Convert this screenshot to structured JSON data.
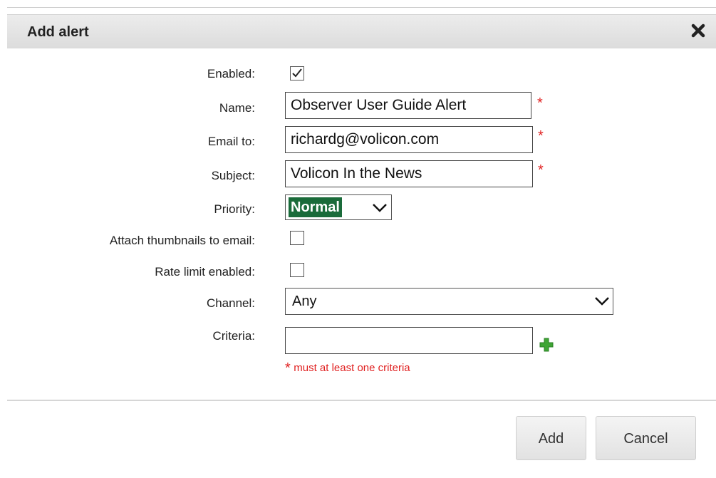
{
  "dialog": {
    "title": "Add alert",
    "close_icon": "close-icon"
  },
  "form": {
    "enabled": {
      "label": "Enabled:",
      "checked": true
    },
    "name": {
      "label": "Name:",
      "value": "Observer User Guide Alert",
      "required_mark": "*"
    },
    "email_to": {
      "label": "Email to:",
      "value": "richardg@volicon.com",
      "required_mark": "*"
    },
    "subject": {
      "label": "Subject:",
      "value": "Volicon In the News",
      "required_mark": "*"
    },
    "priority": {
      "label": "Priority:",
      "selected": "Normal"
    },
    "attach_thumbnails": {
      "label": "Attach thumbnails to email:",
      "checked": false
    },
    "rate_limit": {
      "label": "Rate limit enabled:",
      "checked": false
    },
    "channel": {
      "label": "Channel:",
      "selected": "Any"
    },
    "criteria": {
      "label": "Criteria:",
      "value": "",
      "add_icon": "plus-icon"
    },
    "criteria_hint": {
      "mark": "*",
      "text": "must at least one criteria"
    }
  },
  "buttons": {
    "add": "Add",
    "cancel": "Cancel"
  },
  "colors": {
    "required": "#e02020",
    "priority_highlight": "#1a6b3a",
    "plus_icon": "#3fa535"
  }
}
